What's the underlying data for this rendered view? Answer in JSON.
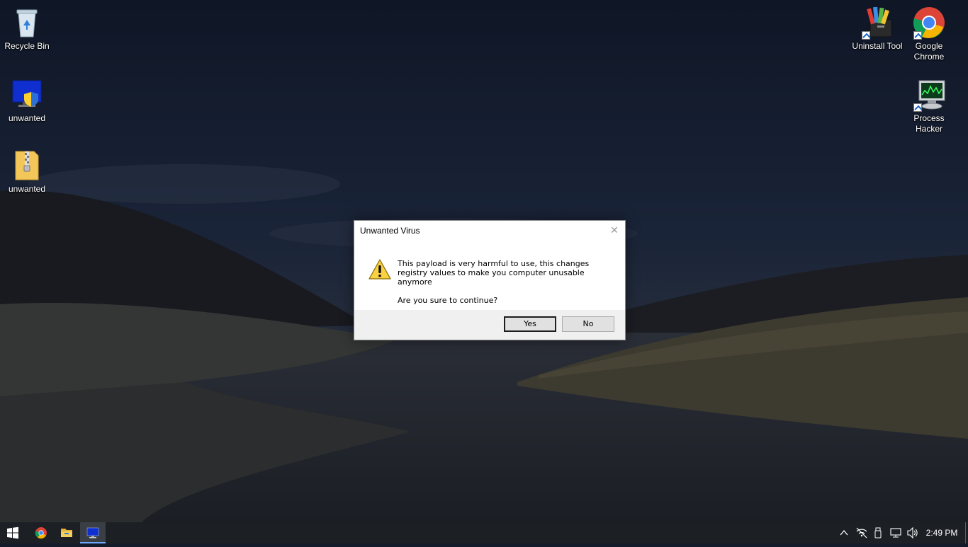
{
  "desktop": {
    "icons_left": [
      {
        "label": "Recycle Bin",
        "icon": "recycle-bin-icon"
      },
      {
        "label": "unwanted",
        "icon": "monitor-shield-icon"
      },
      {
        "label": "unwanted",
        "icon": "zip-folder-icon"
      }
    ],
    "icons_right": [
      {
        "label": "Uninstall Tool",
        "icon": "uninstall-tool-icon"
      },
      {
        "label": "Google Chrome",
        "icon": "chrome-icon"
      },
      {
        "label": "Process Hacker",
        "icon": "process-hacker-icon"
      }
    ]
  },
  "dialog": {
    "title": "Unwanted Virus",
    "close_glyph": "✕",
    "message": "This payload is very harmful to use, this changes registry values to make you computer unusable anymore",
    "question": "Are you sure to continue?",
    "yes_label": "Yes",
    "no_label": "No",
    "icon": "warning-icon"
  },
  "taskbar": {
    "items": [
      {
        "icon": "windows-start-icon"
      },
      {
        "icon": "chrome-icon"
      },
      {
        "icon": "file-explorer-icon"
      },
      {
        "icon": "monitor-app-icon",
        "active": true
      }
    ],
    "tray": [
      "chevron-up-icon",
      "network-off-icon",
      "usb-icon",
      "network-icon",
      "volume-icon"
    ],
    "clock": "2:49 PM"
  },
  "colors": {
    "taskbar": "#1c1f24",
    "dialog_footer": "#f0f0f0",
    "sky": "#141c2c",
    "accent": "#6fa8ff"
  }
}
